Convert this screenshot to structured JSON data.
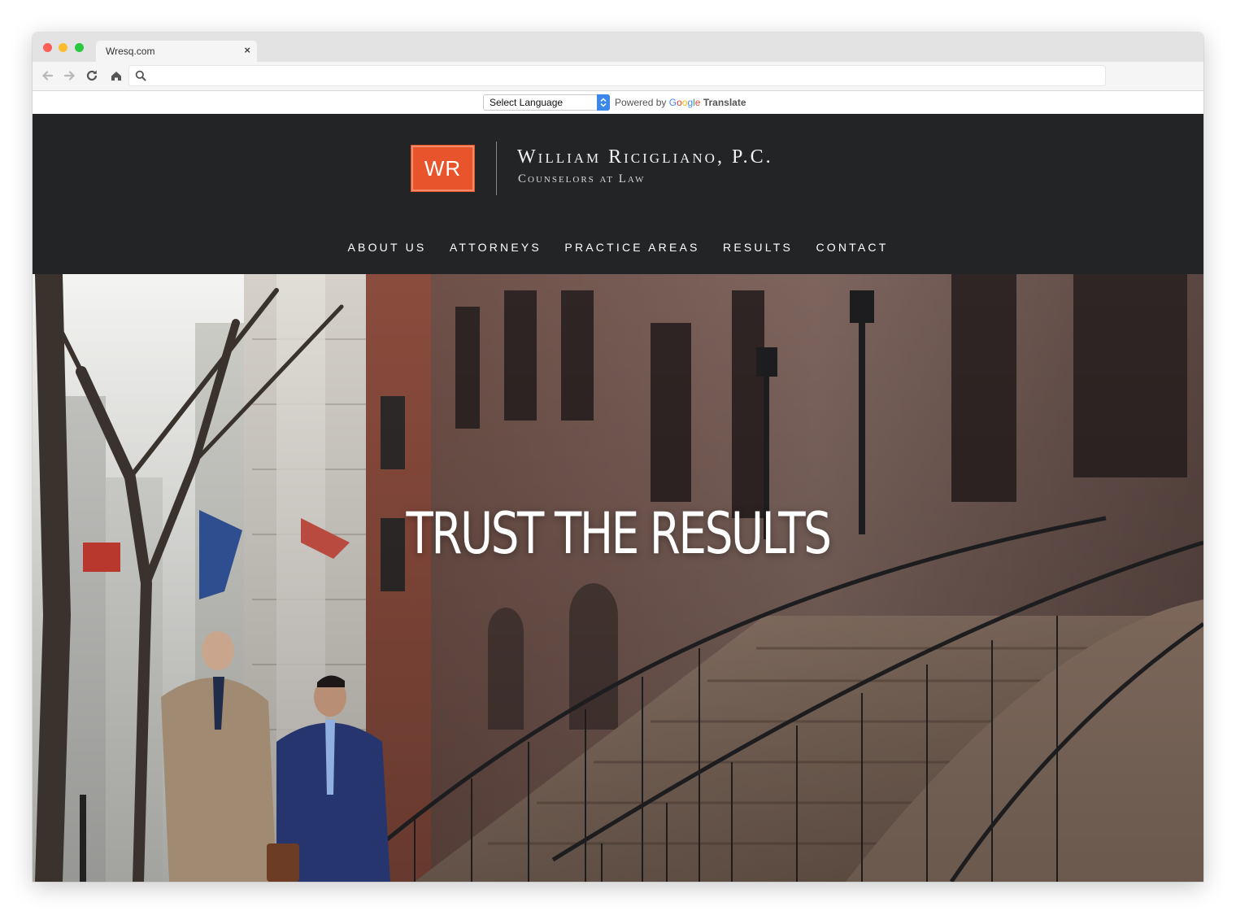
{
  "browser": {
    "tab_title": "Wresq.com",
    "tab_close": "×",
    "address": ""
  },
  "translate": {
    "select_label": "Select Language",
    "powered_by": "Powered by",
    "google": [
      "G",
      "o",
      "o",
      "g",
      "l",
      "e"
    ],
    "translate_word": "Translate"
  },
  "site": {
    "logo_text": "WR",
    "firm_name": "William Ricigliano, P.C.",
    "firm_sub": "Counselors at Law",
    "nav": [
      "ABOUT US",
      "ATTORNEYS",
      "PRACTICE AREAS",
      "RESULTS",
      "CONTACT"
    ]
  },
  "hero": {
    "headline": "TRUST THE RESULTS"
  },
  "colors": {
    "header_bg": "#222426",
    "logo_accent": "#e8542b",
    "select_accent": "#3b88ea"
  },
  "icons": [
    "back-icon",
    "forward-icon",
    "reload-icon",
    "home-icon",
    "search-icon",
    "select-arrows-icon"
  ]
}
